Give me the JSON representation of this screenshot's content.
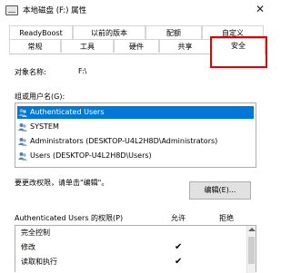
{
  "window": {
    "title": "本地磁盘 (F:) 属性",
    "close_glyph": "✕"
  },
  "tabs": {
    "row1": [
      "ReadyBoost",
      "以前的版本",
      "配额",
      "自定义"
    ],
    "row2": [
      "常规",
      "工具",
      "硬件",
      "共享"
    ],
    "active": "安全"
  },
  "object": {
    "label": "对象名称:",
    "value": "F:\\"
  },
  "groups": {
    "label": "组或用户名(G):",
    "items": [
      "Authenticated Users",
      "SYSTEM",
      "Administrators (DESKTOP-U4L2H8D\\Administrators)",
      "Users (DESKTOP-U4L2H8D\\Users)"
    ]
  },
  "edit_hint": "要更改权限，请单击\"编辑\"。",
  "edit_button": "编辑(E)...",
  "permissions": {
    "header": "Authenticated Users 的权限(P)",
    "allow_label": "允许",
    "deny_label": "拒绝",
    "rows": [
      {
        "name": "完全控制",
        "allow": false,
        "deny": false
      },
      {
        "name": "修改",
        "allow": true,
        "deny": false
      },
      {
        "name": "读取和执行",
        "allow": true,
        "deny": false
      }
    ],
    "check_glyph": "✔"
  },
  "colors": {
    "selection": "#0078d7",
    "highlight_box": "#e30000"
  },
  "icons": {
    "title": "drive-icon",
    "list": "users-group-icon",
    "close": "close-icon"
  }
}
